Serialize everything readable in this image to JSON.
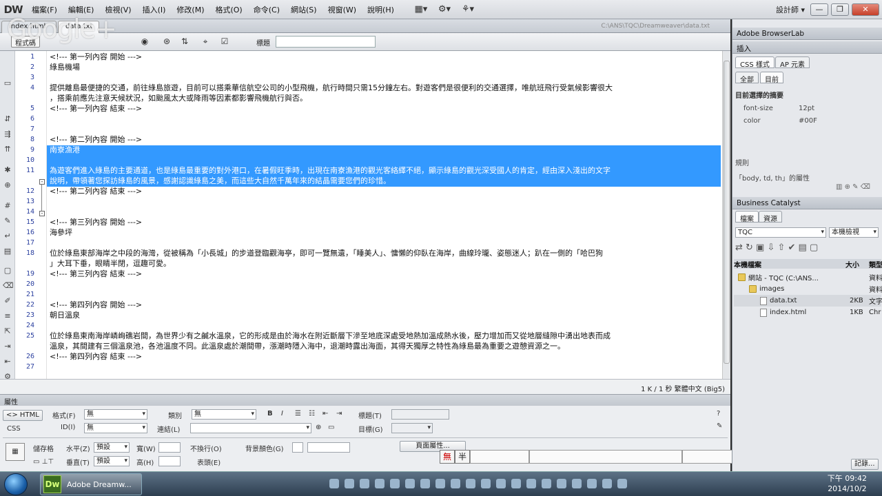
{
  "app": {
    "logo": "DW",
    "workspace": "設計師 ▾",
    "window_buttons": [
      "—",
      "❐",
      "✕"
    ]
  },
  "menu": [
    "檔案(F)",
    "編輯(E)",
    "檢視(V)",
    "插入(I)",
    "修改(M)",
    "格式(O)",
    "命令(C)",
    "網站(S)",
    "視窗(W)",
    "說明(H)"
  ],
  "overlay": {
    "google_plus": "Google+"
  },
  "doc": {
    "tabs": [
      {
        "label": "index.html"
      },
      {
        "label": "data.txt"
      }
    ],
    "path": "C:\\ANS\\TQC\\Dreamweaver\\data.txt",
    "source_button": "程式碼",
    "title_label": "標題",
    "title_value": "",
    "lines": [
      {
        "n": "1",
        "text": "<!--- 第一列內容 開始 --->"
      },
      {
        "n": "2",
        "text": "綠島機場"
      },
      {
        "n": "3",
        "text": ""
      },
      {
        "n": "4",
        "text": "提供離島最便捷的交通，前往綠島旅遊，目前可以搭乘華信航空公司的小型飛機，航行時間只需15分鐘左右。對遊客們是很便利的交通選擇，唯航班飛行受氣候影響很大"
      },
      {
        "n": "",
        "text": "，搭乘前應先注意天候狀況，如颱風太大或降雨等因素都影響飛機航行與否。"
      },
      {
        "n": "5",
        "text": "<!--- 第一列內容 結束 --->"
      },
      {
        "n": "6",
        "text": ""
      },
      {
        "n": "7",
        "text": ""
      },
      {
        "n": "8",
        "text": "<!--- 第二列內容 開始 --->"
      },
      {
        "n": "9",
        "text": "南寮漁港"
      },
      {
        "n": "10",
        "text": ""
      },
      {
        "n": "11",
        "text": "為遊客們進入綠島的主要通道，也是綠島最重要的對外港口，在暑假旺季時，出現在南寮漁港的觀光客絡繹不絕，顯示綠島的觀光深受國人的肯定，經由深入淺出的文字"
      },
      {
        "n": "",
        "text": "說明，帶領著您探訪綠島的風景，感謝認識綠島之美，而這些大自然千萬年來的結晶需要您們的珍惜。"
      },
      {
        "n": "12",
        "text": "<!--- 第二列內容 結束 --->"
      },
      {
        "n": "13",
        "text": ""
      },
      {
        "n": "14",
        "text": ""
      },
      {
        "n": "15",
        "text": "<!--- 第三列內容 開始 --->"
      },
      {
        "n": "16",
        "text": "海參坪"
      },
      {
        "n": "17",
        "text": ""
      },
      {
        "n": "18",
        "text": "位於綠島東部海岸之中段的海灣，從被稱為「小長城」的步道登臨觀海亭，即可一覽無遺，「睡美人」、慵懶的仰臥在海岸，曲線玲瓏、姿態迷人；趴在一側的「哈巴狗"
      },
      {
        "n": "",
        "text": "」大耳下垂，眼睛半閉，逗趣可愛。"
      },
      {
        "n": "19",
        "text": "<!--- 第三列內容 結束 --->"
      },
      {
        "n": "20",
        "text": ""
      },
      {
        "n": "21",
        "text": ""
      },
      {
        "n": "22",
        "text": "<!--- 第四列內容 開始 --->"
      },
      {
        "n": "23",
        "text": "朝日溫泉"
      },
      {
        "n": "24",
        "text": ""
      },
      {
        "n": "25",
        "text": "位於綠島東南海岸嶙峋礁岩間，為世界少有之鹹水溫泉，它的形成是由於海水在附近斷層下滲至地底深處受地熱加溫成熱水後，壓力增加而又從地層縫隙中湧出地表而成"
      },
      {
        "n": "",
        "text": "溫泉，其間建有三個溫泉池，各池溫度不同。此溫泉處於潮間帶，漲潮時隱入海中，退潮時露出海面，其得天獨厚之特性為綠島最為重要之遊憩資源之一。"
      },
      {
        "n": "26",
        "text": "<!--- 第四列內容 結束 --->"
      },
      {
        "n": "27",
        "text": ""
      }
    ],
    "status": "1 K / 1 秒  繁體中文 (Big5)"
  },
  "props": {
    "header": "屬性",
    "html_btn": "<> HTML",
    "css_btn": "CSS",
    "format_label": "格式(F)",
    "format_value": "無",
    "class_label": "類別",
    "class_value": "無",
    "bold": "B",
    "italic": "I",
    "title_label": "標題(T)",
    "id_label": "ID(I)",
    "id_value": "無",
    "link_label": "連結(L)",
    "target_label": "目標(G)",
    "cell_label": "儲存格",
    "horz_label": "水平(Z)",
    "horz_value": "預設",
    "width_label": "寬(W)",
    "nowrap_label": "不換行(O)",
    "bg_label": "背景顏色(G)",
    "page_props": "頁面屬性...",
    "vert_label": "垂直(T)",
    "vert_value": "預設",
    "height_label": "高(H)",
    "header_label": "表頭(E)",
    "ime": [
      "無",
      "半"
    ]
  },
  "panels": {
    "browserlab": "Adobe BrowserLab",
    "insert": "插入",
    "css_tabs": [
      "CSS 樣式",
      "AP 元素"
    ],
    "css_subtabs": [
      "全部",
      "目前"
    ],
    "css_section": "目前選擇的摘要",
    "css_props": [
      {
        "name": "font-size",
        "value": "12pt"
      },
      {
        "name": "color",
        "value": "#00F"
      }
    ],
    "rules_label": "規則",
    "rules_value": "「body, td, th」的屬性",
    "bc": "Business Catalyst",
    "file_tabs": [
      "檔案",
      "資源"
    ],
    "site_select": "TQC",
    "view_select": "本機檢視",
    "file_cols": [
      "本機檔案",
      "大小",
      "類型"
    ],
    "files": [
      {
        "name": "網站 - TQC (C:\\ANS...",
        "size": "",
        "type": "資料",
        "kind": "site",
        "indent": 0
      },
      {
        "name": "images",
        "size": "",
        "type": "資料",
        "kind": "folder",
        "indent": 1
      },
      {
        "name": "data.txt",
        "size": "2KB",
        "type": "文字",
        "kind": "file",
        "indent": 2
      },
      {
        "name": "index.html",
        "size": "1KB",
        "type": "Chr",
        "kind": "file",
        "indent": 2
      }
    ],
    "log_btn": "記錄..."
  },
  "taskbar": {
    "app_label": "Adobe Dreamw...",
    "time": "下午 09:42",
    "date": "2014/10/2"
  }
}
